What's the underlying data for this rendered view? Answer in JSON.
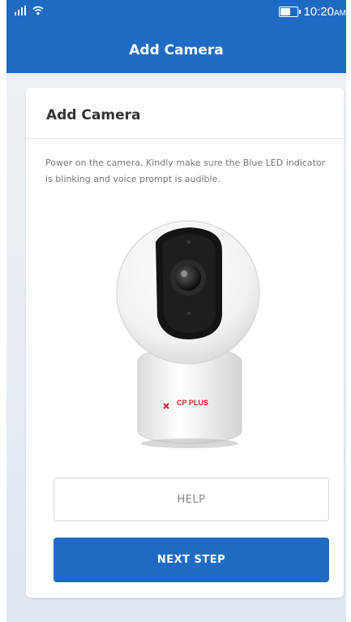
{
  "status_bar": {
    "time": "10:20",
    "time_suffix": "AM",
    "battery_level": 0.65,
    "icons": [
      "signal-icon",
      "wifi-icon",
      "battery-icon"
    ]
  },
  "header": {
    "title": "Add Camera"
  },
  "card": {
    "title": "Add Camera",
    "description": "Power on the camera. Kindly make sure the Blue LED indicator is blinking and voice prompt is audible.",
    "camera_brand": "CP PLUS"
  },
  "buttons": {
    "help_label": "HELP",
    "next_label": "NEXT  STEP"
  },
  "colors": {
    "primary": "#1f6bc4",
    "brand_red": "#d8232a"
  }
}
